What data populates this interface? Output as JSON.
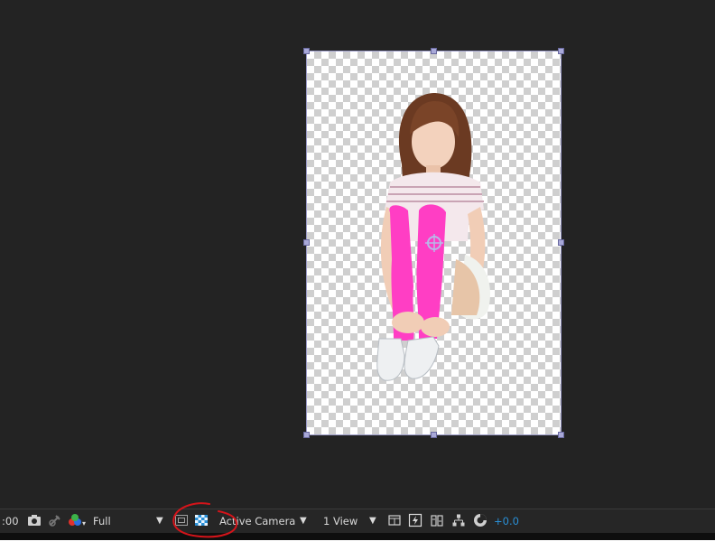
{
  "viewer": {
    "background_color": "#232323"
  },
  "layer": {
    "content": "photo-subject-girl-sitting"
  },
  "toolbar": {
    "timecode_label": ":00",
    "snapshot_icon": "camera-icon",
    "show_snapshot_icon": "show-snapshot-icon",
    "channels_icon": "rgb-channels-icon",
    "resolution_value": "Full",
    "region_of_interest_icon": "region-of-interest-icon",
    "transparency_grid_icon": "transparency-grid-icon",
    "camera_value": "Active Camera",
    "view_layout_value": "1 View",
    "pixel_aspect_icon": "pixel-aspect-icon",
    "fast_preview_icon": "fast-preview-icon",
    "timeline_icon": "timeline-icon",
    "flowchart_icon": "flowchart-icon",
    "exposure_reset_icon": "exposure-reset-icon",
    "exposure_value": "+0.0"
  },
  "colors": {
    "accent_blue": "#2a8fd6",
    "annotation_red": "#d4141a",
    "handle": "#a8a8d8"
  }
}
